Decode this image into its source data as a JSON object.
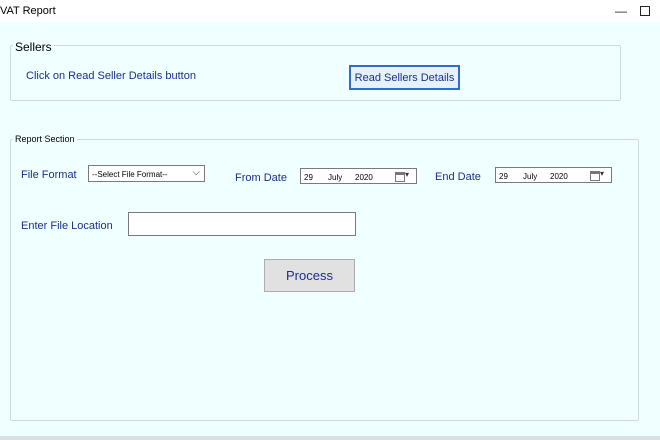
{
  "window": {
    "title": "VAT Report",
    "minimize_glyph": "—"
  },
  "sellers": {
    "group_label": "Sellers",
    "hint": "Click on Read Seller Details button",
    "read_button": "Read Sellers Details"
  },
  "report": {
    "group_label": "Report Section",
    "file_format_label": "File Format",
    "file_format_value": "--Select File Format--",
    "from_date_label": "From Date",
    "from_date": {
      "day": "29",
      "month": "July",
      "year": "2020"
    },
    "end_date_label": "End Date",
    "end_date": {
      "day": "29",
      "month": "July",
      "year": "2020"
    },
    "file_location_label": "Enter File Location",
    "file_location_value": "",
    "process_button": "Process"
  },
  "icons": {
    "dropdown": "chevron-down-icon",
    "calendar": "calendar-icon",
    "minimize": "minimize-icon",
    "maximize": "maximize-icon"
  },
  "colors": {
    "background": "#f0ffff",
    "label_text": "#1b2e8f",
    "focus_border": "#2f6ccf"
  }
}
